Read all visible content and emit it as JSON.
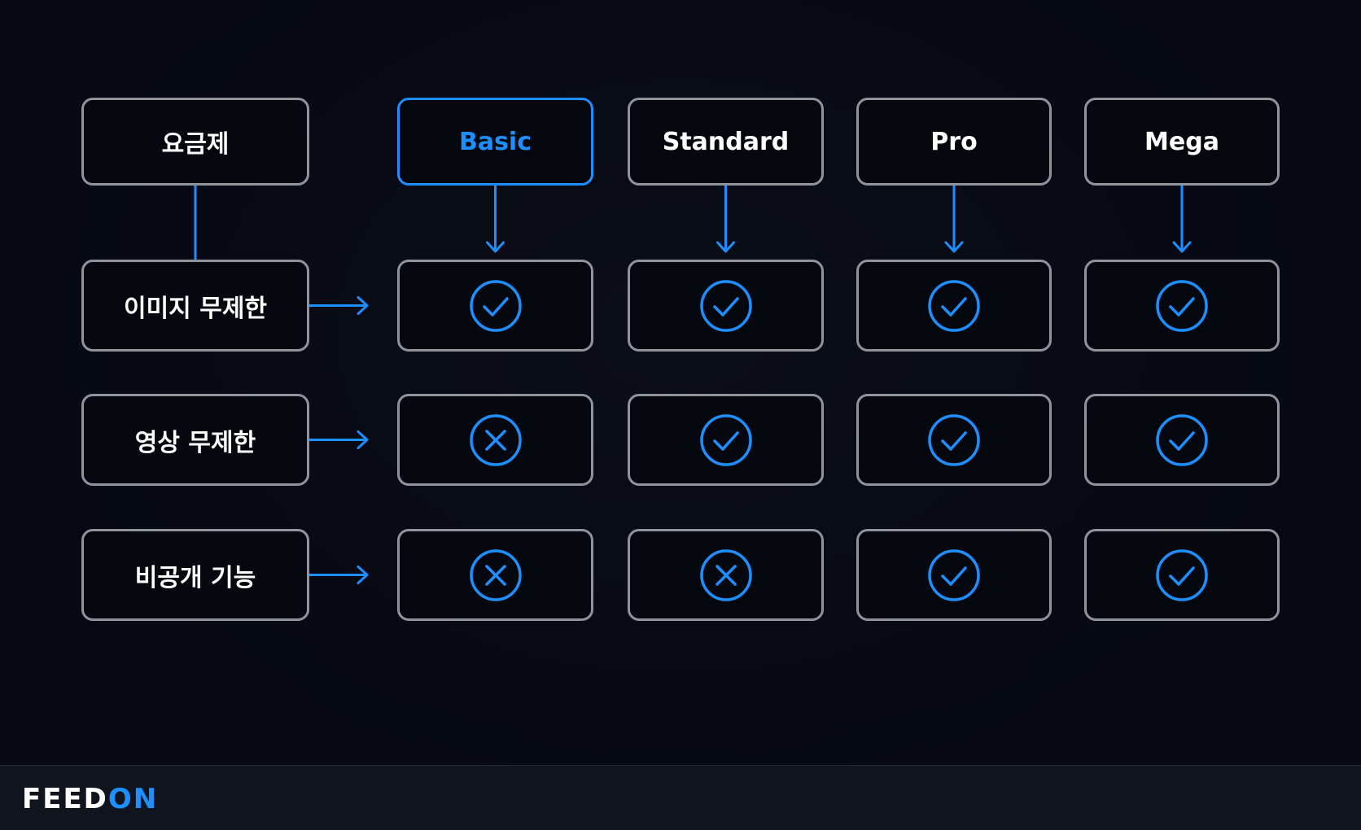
{
  "colors": {
    "accent": "#1e8fff",
    "border": "#8f949b",
    "background": "#060912",
    "text": "#ffffff",
    "footer": "#0f141e"
  },
  "header_label": "요금제",
  "plans": [
    "Basic",
    "Standard",
    "Pro",
    "Mega"
  ],
  "highlighted_plan": "Basic",
  "features": [
    {
      "name": "이미지 무제한",
      "support": [
        true,
        true,
        true,
        true
      ]
    },
    {
      "name": "영상 무제한",
      "support": [
        false,
        true,
        true,
        true
      ]
    },
    {
      "name": "비공개 기능",
      "support": [
        false,
        false,
        true,
        true
      ]
    }
  ],
  "icons": {
    "yes": "check-circle-icon",
    "no": "x-circle-icon"
  },
  "footer": {
    "brand_part1": "FEED",
    "brand_part2": "ON"
  }
}
